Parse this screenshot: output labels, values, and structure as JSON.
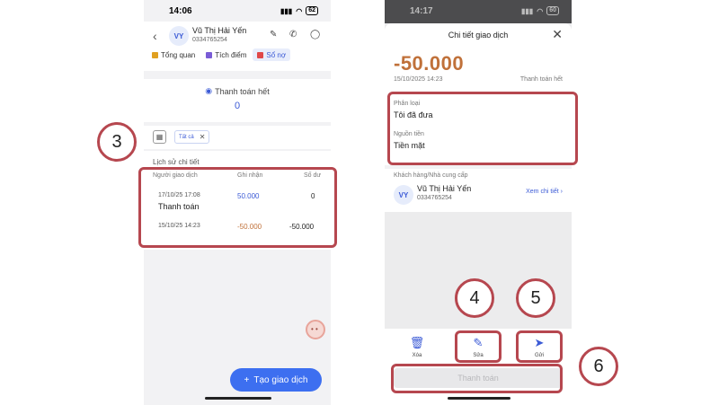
{
  "left_screen": {
    "status": {
      "time": "14:06",
      "battery": "62"
    },
    "contact": {
      "initials": "VY",
      "name": "Vũ Thị Hải Yến",
      "phone": "0334765254"
    },
    "tabs": [
      {
        "label": "Tổng quan",
        "color": "#e0a020"
      },
      {
        "label": "Tích điểm",
        "color": "#7a5cd6"
      },
      {
        "label": "Sổ nợ",
        "color": "#e04848"
      }
    ],
    "summary": {
      "label": "Thanh toán hết",
      "value": "0"
    },
    "filter": {
      "chip_label": "Tất cả"
    },
    "history": {
      "title": "Lịch sử chi tiết",
      "columns": [
        "Người giao dịch",
        "Ghi nhận",
        "Số dư"
      ],
      "rows": [
        {
          "datetime": "17/10/25 17:08",
          "type": "Thanh toán",
          "amount": "50.000",
          "balance": "0"
        },
        {
          "datetime": "15/10/25 14:23",
          "type": "",
          "amount": "-50.000",
          "balance": "-50.000"
        }
      ]
    },
    "fab_label": "Tạo giao dịch"
  },
  "right_screen": {
    "status": {
      "time": "14:17",
      "battery": "60"
    },
    "sheet_title": "Chi tiết giao dịch",
    "amount": "-50.000",
    "date": "15/10/2025 14:23",
    "status_label": "Thanh toán hết",
    "category_label": "Phân loại",
    "category_value": "Tôi đã đưa",
    "source_label": "Nguồn tiền",
    "source_value": "Tiền mặt",
    "partner_label": "Khách hàng/Nhà cung cấp",
    "partner": {
      "initials": "VY",
      "name": "Vũ Thị Hải Yến",
      "phone": "0334765254"
    },
    "view_detail": "Xem chi tiết",
    "actions": [
      {
        "label": "Xóa",
        "icon": "trash-icon",
        "color": "#3c5bd6"
      },
      {
        "label": "Sửa",
        "icon": "pencil-icon",
        "color": "#3c5bd6"
      },
      {
        "label": "Gửi",
        "icon": "send-icon",
        "color": "#3c5bd6"
      }
    ],
    "pay_button": "Thanh toán"
  },
  "annotations": {
    "color": "#b6474f",
    "badges": [
      "3",
      "4",
      "5",
      "6"
    ]
  }
}
